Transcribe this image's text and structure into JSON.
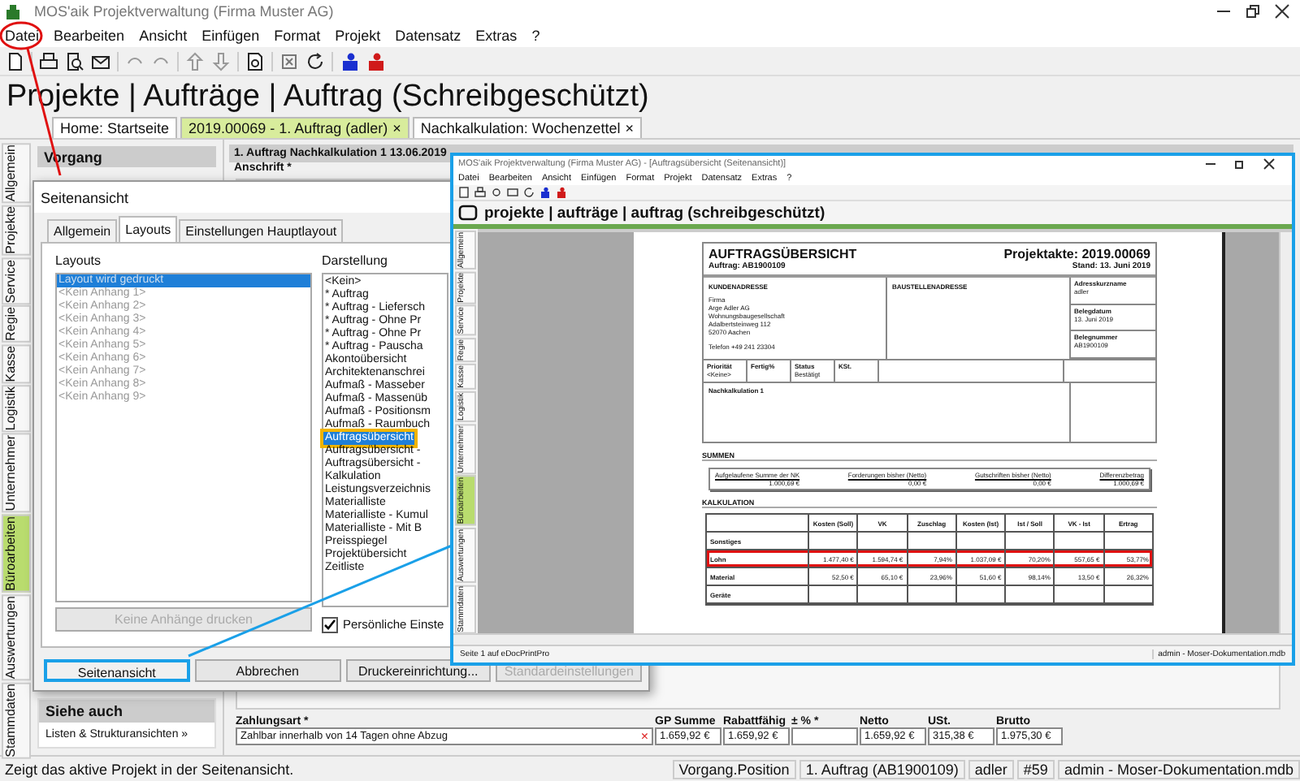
{
  "window": {
    "title": "MOS'aik Projektverwaltung (Firma Muster AG)"
  },
  "menu": [
    "Datei",
    "Bearbeiten",
    "Ansicht",
    "Einfügen",
    "Format",
    "Projekt",
    "Datensatz",
    "Extras",
    "?"
  ],
  "heading": "Projekte | Aufträge | Auftrag (Schreibgeschützt)",
  "tabs": [
    {
      "label": "Home: Startseite",
      "selected": false
    },
    {
      "label": "2019.00069 - 1. Auftrag (adler)",
      "selected": true,
      "close": "×"
    },
    {
      "label": "Nachkalkulation: Wochenzettel",
      "selected": false,
      "close": "×"
    }
  ],
  "side_tabs": [
    {
      "label": "Allgemein",
      "selected": false
    },
    {
      "label": "Projekte",
      "selected": false
    },
    {
      "label": "Service",
      "selected": false
    },
    {
      "label": "Regie",
      "selected": false
    },
    {
      "label": "Kasse",
      "selected": false
    },
    {
      "label": "Logistik",
      "selected": false
    },
    {
      "label": "Unternehmer",
      "selected": false
    },
    {
      "label": "Büroarbeiten",
      "selected": true
    },
    {
      "label": "Auswertungen",
      "selected": false
    },
    {
      "label": "Stammdaten",
      "selected": false
    }
  ],
  "left_panel": {
    "vorgang_title": "Vorgang",
    "see_also_title": "Siehe auch",
    "see_also_links": [
      "Listen & Strukturansichten »"
    ]
  },
  "content": {
    "title": "1. Auftrag Nachkalkulation 1 13.06.2019",
    "field_label": "Anschrift *"
  },
  "payment": {
    "label": "Zahlungsart *",
    "value": "Zahlbar innerhalb von 14 Tagen ohne Abzug",
    "clear": "×"
  },
  "totals": [
    {
      "label": "GP Summe",
      "value": "1.659,92 €"
    },
    {
      "label": "Rabattfähig",
      "value": "1.659,92 €"
    },
    {
      "label": "± % *"
    },
    {
      "label": "Netto",
      "value": "1.659,92 €"
    },
    {
      "label": "USt.",
      "value": "315,38 €"
    },
    {
      "label": "Brutto",
      "value": "1.975,30 €"
    }
  ],
  "status_bar": {
    "message": "Zeigt das aktive Projekt in der Seitenansicht.",
    "fields": [
      "Vorgang.Position",
      "1. Auftrag (AB1900109)",
      "adler",
      "#59",
      "admin - Moser-Dokumentation.mdb"
    ]
  },
  "dialog": {
    "title": "Seitenansicht",
    "tabs": [
      {
        "label": "Allgemein",
        "selected": false
      },
      {
        "label": "Layouts",
        "selected": true
      },
      {
        "label": "Einstellungen Hauptlayout",
        "selected": false
      }
    ],
    "layouts_label": "Layouts",
    "layouts": [
      {
        "label": "Layout wird gedruckt",
        "selected": true
      },
      {
        "label": "<Kein Anhang 1>",
        "selected": false
      },
      {
        "label": "<Kein Anhang 2>",
        "selected": false
      },
      {
        "label": "<Kein Anhang 3>",
        "selected": false
      },
      {
        "label": "<Kein Anhang 4>",
        "selected": false
      },
      {
        "label": "<Kein Anhang 5>",
        "selected": false
      },
      {
        "label": "<Kein Anhang 6>",
        "selected": false
      },
      {
        "label": "<Kein Anhang 7>",
        "selected": false
      },
      {
        "label": "<Kein Anhang 8>",
        "selected": false
      },
      {
        "label": "<Kein Anhang 9>",
        "selected": false
      }
    ],
    "display_label": "Darstellung",
    "display": [
      {
        "label": "<Kein>",
        "selected": false
      },
      {
        "label": "* Auftrag",
        "selected": false
      },
      {
        "label": "* Auftrag - Liefersch",
        "selected": false
      },
      {
        "label": "* Auftrag - Ohne Pr",
        "selected": false
      },
      {
        "label": "* Auftrag - Ohne Pr",
        "selected": false
      },
      {
        "label": "* Auftrag - Pauscha",
        "selected": false
      },
      {
        "label": "Akontoübersicht",
        "selected": false
      },
      {
        "label": "Architektenanschrei",
        "selected": false
      },
      {
        "label": "Aufmaß - Masseber",
        "selected": false
      },
      {
        "label": "Aufmaß - Massenüb",
        "selected": false
      },
      {
        "label": "Aufmaß - Positionsm",
        "selected": false
      },
      {
        "label": "Aufmaß - Raumbuch",
        "selected": false
      },
      {
        "label": "Auftragsübersicht",
        "selected": true
      },
      {
        "label": "Auftragsübersicht -",
        "selected": false
      },
      {
        "label": "Auftragsübersicht -",
        "selected": false
      },
      {
        "label": "Kalkulation",
        "selected": false
      },
      {
        "label": "Leistungsverzeichnis",
        "selected": false
      },
      {
        "label": "Materialliste",
        "selected": false
      },
      {
        "label": "Materialliste - Kumul",
        "selected": false
      },
      {
        "label": "Materialliste - Mit B",
        "selected": false
      },
      {
        "label": "Preisspiegel",
        "selected": false
      },
      {
        "label": "Projektübersicht",
        "selected": false
      },
      {
        "label": "Zeitliste",
        "selected": false
      }
    ],
    "no_attachments_button": {
      "label": "Keine Anhänge drucken",
      "disabled": true
    },
    "personal_settings": {
      "label": "Persönliche Einste",
      "checked": true
    },
    "buttons": [
      {
        "label": "Seitenansicht",
        "disabled": false,
        "highlighted": true
      },
      {
        "label": "Abbrechen",
        "disabled": false,
        "highlighted": false
      },
      {
        "label": "Druckereinrichtung...",
        "disabled": false,
        "highlighted": false
      },
      {
        "label": "Standardeinstellungen",
        "disabled": true,
        "highlighted": false
      }
    ]
  },
  "preview_window": {
    "title": "MOS'aik Projektverwaltung (Firma Muster AG) - [Auftragsübersicht (Seitenansicht)]",
    "menu": [
      "Datei",
      "Bearbeiten",
      "Ansicht",
      "Einfügen",
      "Format",
      "Projekt",
      "Datensatz",
      "Extras",
      "?"
    ],
    "heading": "projekte | aufträge | auftrag (schreibgeschützt)",
    "side_tabs": [
      {
        "label": "Allgemein",
        "selected": false
      },
      {
        "label": "Projekte",
        "selected": false
      },
      {
        "label": "Service",
        "selected": false
      },
      {
        "label": "Regie",
        "selected": false
      },
      {
        "label": "Kasse",
        "selected": false
      },
      {
        "label": "Logistik",
        "selected": false
      },
      {
        "label": "Unternehmer",
        "selected": false
      },
      {
        "label": "Büroarbeiten",
        "selected": true
      },
      {
        "label": "Auswertungen",
        "selected": false
      },
      {
        "label": "Stammdaten",
        "selected": false
      }
    ],
    "status_bar": {
      "message": "Seite 1 auf eDocPrintPro",
      "fields": [
        "admin - Moser-Dokumentation.mdb"
      ]
    },
    "document": {
      "title": "AUFTRAGSÜBERSICHT",
      "project": "Projektakte: 2019.00069",
      "order": "Auftrag: AB1900109",
      "date": "Stand: 13. Juni 2019",
      "customer": {
        "heading": "KUNDENADRESSE",
        "lines": [
          "Firma",
          "Arge Adler AG",
          "Wohnungsbaugesellschaft",
          "Adalbertsteinweg 112",
          "52070 Aachen"
        ],
        "phone": "Telefon +49 241 23304"
      },
      "site": {
        "heading": "BAUSTELLENADRESSE"
      },
      "meta": [
        {
          "label": "Adresskurzname",
          "value": "adler"
        },
        {
          "label": "Belegdatum",
          "value": "13. Juni 2019"
        },
        {
          "label": "Belegnummer",
          "value": "AB1900109"
        }
      ],
      "fields": [
        {
          "label": "Priorität",
          "value": "<Keine>"
        },
        {
          "label": "Fertig%"
        },
        {
          "label": "Status",
          "value": "Bestätigt"
        },
        {
          "label": "KSt."
        }
      ],
      "note": "Nachkalkulation 1",
      "sums_heading": "SUMMEN",
      "sums": [
        {
          "label": "Aufgelaufene Summe der NK",
          "value": "1.000,69 €"
        },
        {
          "label": "Forderungen bisher (Netto)",
          "value": "0,00 €"
        },
        {
          "label": "Gutschriften bisher (Netto)",
          "value": "0,00 €"
        },
        {
          "label": "Differenzbetrag",
          "value": "1.000,69 €"
        }
      ],
      "calc_heading": "KALKULATION",
      "calc_columns": [
        "Kosten (Soll)",
        "VK",
        "Zuschlag",
        "Kosten (Ist)",
        "Ist / Soll",
        "VK - Ist",
        "Ertrag"
      ],
      "calc_rows": [
        {
          "label": "Sonstiges",
          "highlighted": false
        },
        {
          "label": "Lohn",
          "cells": [
            "1.477,40 €",
            "1.594,74 €",
            "7,94%",
            "1.037,09 €",
            "70,20%",
            "557,65 €",
            "53,77%"
          ],
          "highlighted": true
        },
        {
          "label": "Material",
          "cells": [
            "52,50 €",
            "65,10 €",
            "23,96%",
            "51,60 €",
            "98,14%",
            "13,50 €",
            "26,32%"
          ],
          "highlighted": false
        },
        {
          "label": "Geräte",
          "highlighted": false
        }
      ]
    }
  }
}
